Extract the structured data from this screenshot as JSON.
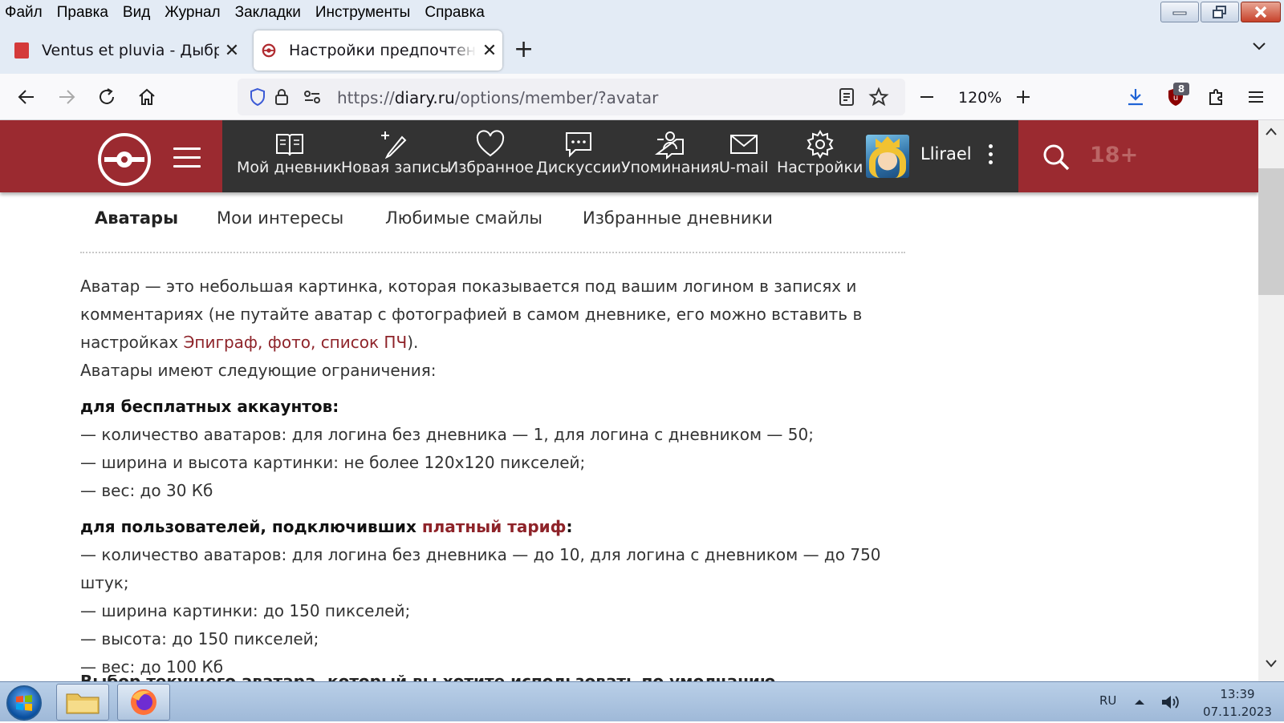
{
  "menu": [
    "Файл",
    "Правка",
    "Вид",
    "Журнал",
    "Закладки",
    "Инструменты",
    "Справка"
  ],
  "tabs": [
    {
      "title": "Ventus et pluvia - Дыбр",
      "active": false
    },
    {
      "title": "Настройки предпочтений",
      "active": true
    }
  ],
  "nav": {
    "url_scheme": "https://",
    "url_host": "diary.ru",
    "url_path": "/options/member/?avatar",
    "zoom": "120%",
    "ext_badge": "8"
  },
  "site": {
    "nav_items": [
      "Мой дневник",
      "Новая запись",
      "Избранное",
      "Дискуссии",
      "Упоминания",
      "U-mail",
      "Настройки"
    ],
    "username": "Llirael",
    "age_label": "18+"
  },
  "subtabs": [
    "Аватары",
    "Мои интересы",
    "Любимые смайлы",
    "Избранные дневники"
  ],
  "content": {
    "intro_1": "Аватар — это небольшая картинка, которая показывается под вашим логином в записях и комментариях (не путайте аватар с фотографией в самом дневнике, его можно вставить в настройках ",
    "intro_link": "Эпиграф, фото, список ПЧ",
    "intro_2": ").",
    "limits_intro": "Аватары имеют следующие ограничения:",
    "free_heading": "для бесплатных аккаунтов:",
    "free_items": [
      "— количество аватаров: для логина без дневника — 1, для логина с дневником — 50;",
      "— ширина и высота картинки: не более 120х120 пикселей;",
      "— вес: до 30 Кб"
    ],
    "paid_heading_1": "для пользователей, подключивших ",
    "paid_link": "платный тариф",
    "paid_heading_2": ":",
    "paid_items": [
      "— количество аватаров: для логина без дневника — до 10, для логина с дневником — до 750 штук;",
      "— ширина картинки: до 150 пикселей;",
      "— высота: до 150 пикселей;",
      "— вес: до 100 Кб"
    ],
    "cut_line": "Выбор текущего аватара, который вы хотите использовать по умолчанию"
  },
  "taskbar": {
    "lang": "RU",
    "time": "13:39",
    "date": "07.11.2023"
  },
  "colors": {
    "brand_red": "#9b2a30",
    "header_dark": "#333333",
    "link": "#8e2329"
  }
}
